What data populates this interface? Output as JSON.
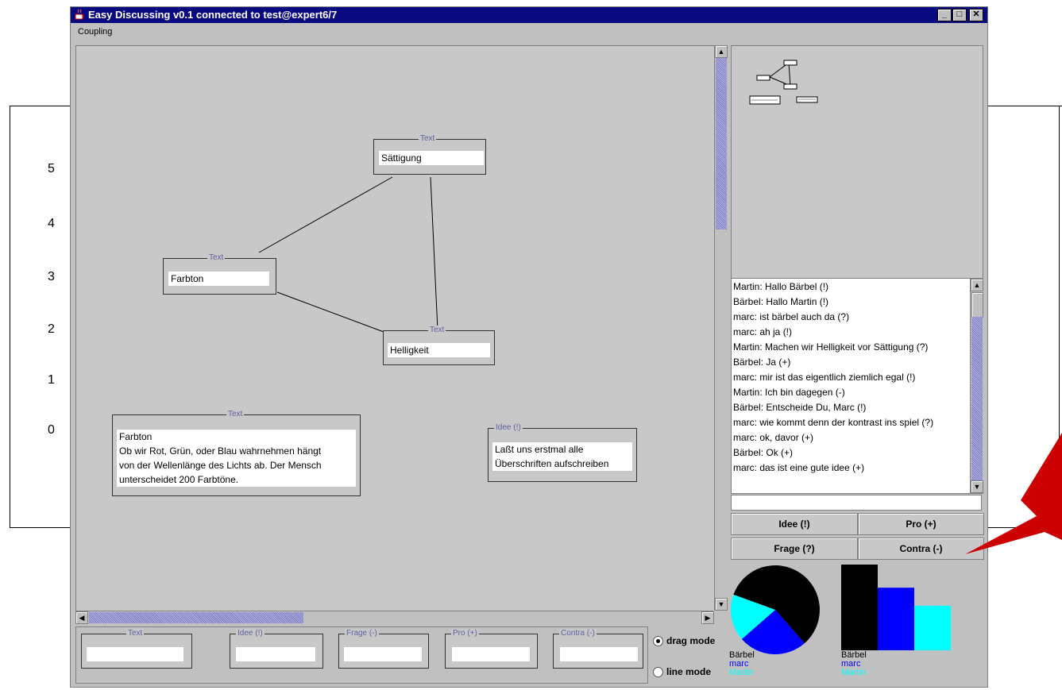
{
  "background": {
    "y_ticks": [
      "5",
      "4",
      "3",
      "2",
      "1",
      "0"
    ]
  },
  "window": {
    "title": "Easy Discussing v0.1 connected to test@expert6/7",
    "controls": [
      "_",
      "□",
      "✕"
    ]
  },
  "menu": {
    "items": [
      "Coupling"
    ]
  },
  "nodes": [
    {
      "type": "Text",
      "text": "Sättigung"
    },
    {
      "type": "Text",
      "text": "Farbton"
    },
    {
      "type": "Text",
      "text": "Helligkeit"
    },
    {
      "type": "Text",
      "text": "Farbton\nOb wir Rot, Grün, oder Blau wahrnehmen hängt\nvon der Wellenlänge des Lichts ab. Der Mensch\nunterscheidet 200 Farbtöne."
    },
    {
      "type": "Idee (!)",
      "text": "Laßt uns erstmal alle\nÜberschriften aufschreiben"
    }
  ],
  "chat": [
    "Martin: Hallo Bärbel (!)",
    "Bärbel: Hallo Martin (!)",
    "marc: ist bärbel auch da (?)",
    "marc: ah ja (!)",
    "Martin: Machen wir Helligkeit vor Sättigung (?)",
    "Bärbel: Ja (+)",
    "marc: mir ist das eigentlich ziemlich egal (!)",
    "Martin: Ich bin dagegen (-)",
    "Bärbel: Entscheide Du, Marc (!)",
    "marc: wie kommt denn der kontrast ins spiel (?)",
    "marc: ok, davor (+)",
    "Bärbel: Ok (+)",
    "marc: das ist eine gute idee (+)"
  ],
  "chat_input": "",
  "buttons": {
    "idee": "Idee (!)",
    "pro": "Pro (+)",
    "frage": "Frage (?)",
    "contra": "Contra (-)"
  },
  "palette": [
    "Text",
    "Idee (!)",
    "Frage (-)",
    "Pro (+)",
    "Contra (-)"
  ],
  "modes": {
    "drag": "drag mode",
    "line": "line mode",
    "selected": "drag"
  },
  "participants": [
    {
      "name": "Bärbel",
      "color": "#000000"
    },
    {
      "name": "marc",
      "color": "#0000ff"
    },
    {
      "name": "Martin",
      "color": "#00ffff"
    }
  ],
  "colors": {
    "titlebar": "#0a0a80",
    "annotation_arrow": "#cc0000"
  },
  "stats": {
    "pie_share": [
      0.58,
      0.25,
      0.17
    ],
    "bar_values": [
      1.0,
      0.73,
      0.52
    ]
  }
}
